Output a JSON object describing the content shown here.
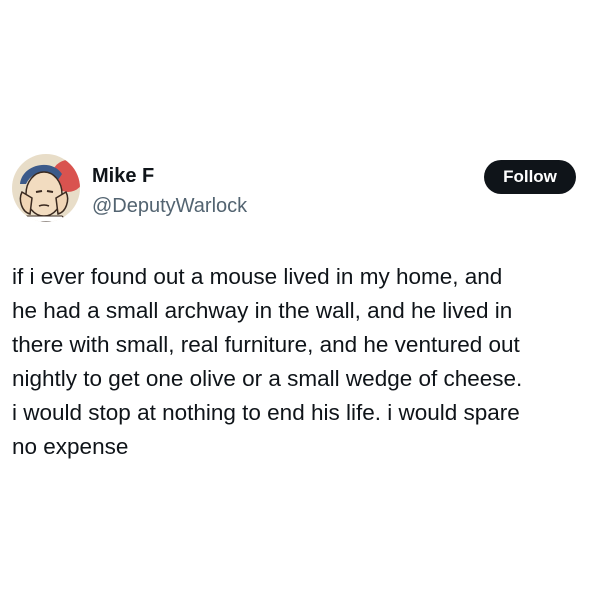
{
  "author": {
    "display_name": "Mike F",
    "handle": "@DeputyWarlock",
    "avatar_icon": "comic-man-face-avatar"
  },
  "follow_button": {
    "label": "Follow",
    "background": "#0f1419",
    "text_color": "#ffffff"
  },
  "tweet": {
    "lines": [
      "if i ever found out a mouse lived in my home, and",
      "he had a small archway in the wall, and he lived in",
      "there with small, real furniture, and he ventured out",
      "nightly to get one olive or a small wedge of cheese.",
      "i would stop at nothing to end his life. i would spare",
      "no expense"
    ]
  }
}
